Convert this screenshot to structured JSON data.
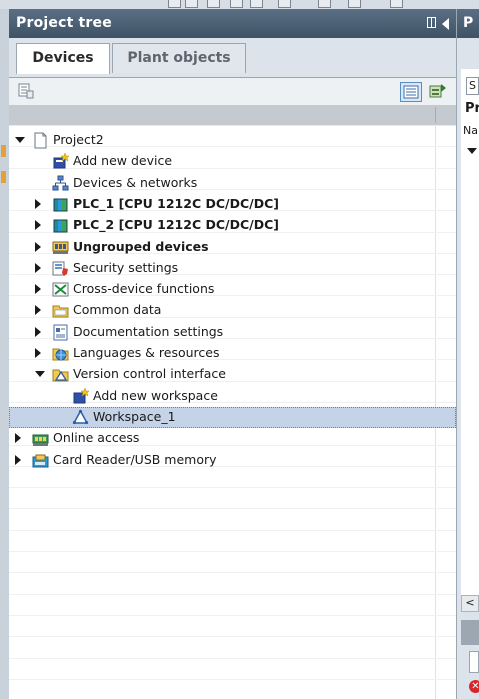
{
  "panel": {
    "title": "Project tree",
    "tabs": [
      {
        "label": "Devices",
        "active": true
      },
      {
        "label": "Plant objects",
        "active": false
      }
    ]
  },
  "tree": [
    {
      "label": "Project2",
      "icon": "project-file-icon",
      "expander": "down",
      "level": 0,
      "bold": false
    },
    {
      "label": "Add new device",
      "icon": "add-device-icon",
      "expander": "none",
      "level": 1,
      "bold": false
    },
    {
      "label": "Devices & networks",
      "icon": "network-icon",
      "expander": "none",
      "level": 1,
      "bold": false
    },
    {
      "label": "PLC_1 [CPU 1212C DC/DC/DC]",
      "icon": "plc-icon",
      "expander": "right",
      "level": 1,
      "bold": true
    },
    {
      "label": "PLC_2 [CPU 1212C DC/DC/DC]",
      "icon": "plc-icon",
      "expander": "right",
      "level": 1,
      "bold": true
    },
    {
      "label": "Ungrouped devices",
      "icon": "ungrouped-devices-icon",
      "expander": "right",
      "level": 1,
      "bold": true
    },
    {
      "label": "Security settings",
      "icon": "security-settings-icon",
      "expander": "right",
      "level": 1,
      "bold": false
    },
    {
      "label": "Cross-device functions",
      "icon": "cross-device-icon",
      "expander": "right",
      "level": 1,
      "bold": false
    },
    {
      "label": "Common data",
      "icon": "folder-icon",
      "expander": "right",
      "level": 1,
      "bold": false
    },
    {
      "label": "Documentation settings",
      "icon": "documentation-icon",
      "expander": "right",
      "level": 1,
      "bold": false
    },
    {
      "label": "Languages & resources",
      "icon": "languages-icon",
      "expander": "right",
      "level": 1,
      "bold": false
    },
    {
      "label": "Version control interface",
      "icon": "version-control-icon",
      "expander": "down",
      "level": 1,
      "bold": false
    },
    {
      "label": "Add new workspace",
      "icon": "add-workspace-icon",
      "expander": "none",
      "level": 2,
      "bold": false
    },
    {
      "label": "Workspace_1",
      "icon": "workspace-icon",
      "expander": "none",
      "level": 2,
      "bold": false,
      "selected": true
    },
    {
      "label": "Online access",
      "icon": "online-access-icon",
      "expander": "right",
      "level": 0,
      "bold": false
    },
    {
      "label": "Card Reader/USB memory",
      "icon": "card-reader-icon",
      "expander": "right",
      "level": 0,
      "bold": false
    }
  ],
  "right_panel": {
    "title_fragment": "P",
    "box_text": "S",
    "header_text": "Pr",
    "column_text": "Na",
    "scroll_arrow": "<",
    "error_glyph": "✕"
  },
  "colors": {
    "title_bar": "#4b6075",
    "selection": "#c4d3e8",
    "panel_bg": "#e6eaef"
  }
}
